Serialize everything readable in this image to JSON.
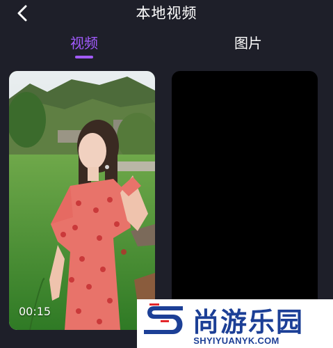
{
  "header": {
    "title": "本地视频",
    "back_icon": "chevron-left-icon"
  },
  "tabs": [
    {
      "label": "视频",
      "active": true
    },
    {
      "label": "图片",
      "active": false
    }
  ],
  "colors": {
    "background": "#1e1f29",
    "accent": "#a35bff",
    "text": "#ffffff",
    "watermark_blue": "#1c3f96",
    "watermark_red": "#e3262b"
  },
  "media": [
    {
      "type": "video",
      "duration": "00:15"
    },
    {
      "type": "image"
    }
  ],
  "watermark": {
    "name": "尚游乐园",
    "url": "SHYIYUANYK.COM"
  }
}
